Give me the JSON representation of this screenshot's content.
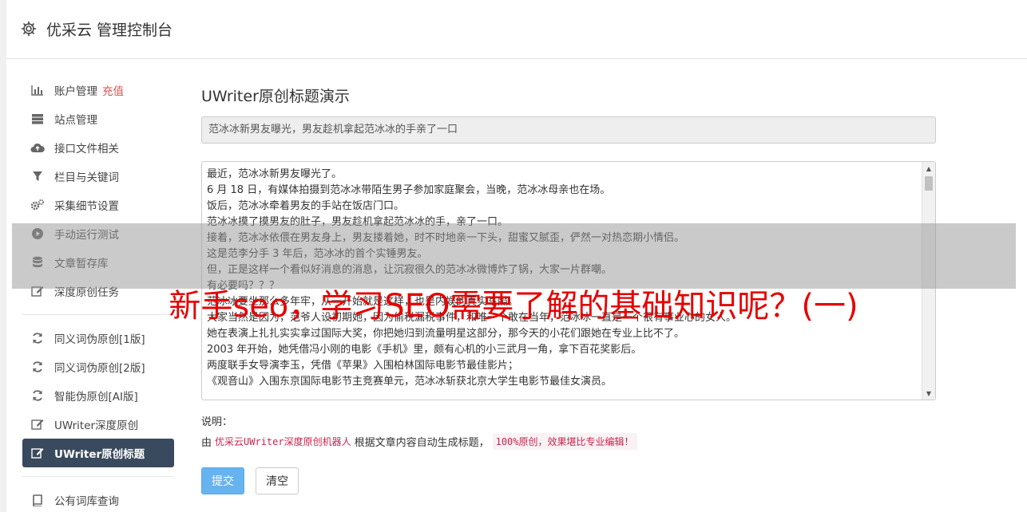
{
  "header": {
    "title": "优采云 管理控制台"
  },
  "sidebar": {
    "items": [
      {
        "label": "账户管理",
        "badge": "充值",
        "icon": "bar-chart-icon"
      },
      {
        "label": "站点管理",
        "icon": "server-icon"
      },
      {
        "label": "接口文件相关",
        "icon": "cloud-upload-icon"
      },
      {
        "label": "栏目与关键词",
        "icon": "filter-icon"
      },
      {
        "label": "采集细节设置",
        "icon": "gears-icon"
      },
      {
        "label": "手动运行测试",
        "icon": "play-icon"
      },
      {
        "label": "文章暂存库",
        "icon": "database-icon"
      },
      {
        "label": "深度原创任务",
        "icon": "edit-icon"
      },
      {
        "label": "同义词伪原创[1版]",
        "icon": "refresh-icon"
      },
      {
        "label": "同义词伪原创[2版]",
        "icon": "refresh-icon"
      },
      {
        "label": "智能伪原创[AI版]",
        "icon": "refresh-icon"
      },
      {
        "label": "UWriter深度原创",
        "icon": "edit-icon"
      },
      {
        "label": "UWriter原创标题",
        "icon": "edit-icon"
      },
      {
        "label": "公有词库查询",
        "icon": "book-icon"
      }
    ]
  },
  "main": {
    "page_title": "UWriter原创标题演示",
    "generated_title": "范冰冰新男友曝光，男友趁机拿起范冰冰的手亲了一口",
    "content_lines": [
      "最近，范冰冰新男友曝光了。",
      "6 月 18 日，有媒体拍摄到范冰冰带陌生男子参加家庭聚会，当晚，范冰冰母亲也在场。",
      "饭后，范冰冰牵着男友的手站在饭店门口。",
      "范冰冰摸了摸男友的肚子，男友趁机拿起范冰冰的手，亲了一口。",
      "接着，范冰冰依偎在男友身上，男友搂着她，时不时地亲一下头，甜蜜又腻歪，俨然一对热恋期小情侣。",
      "这是范李分手 3 年后，范冰冰的首个实锤男友。",
      "但，正是这样一个看似好消息的消息，让沉寂很久的范冰冰微博炸了锅，大家一片群嘲。",
      "有必要吗？？？",
      "范冰冰要坐那么多年牢，从一开始就是这样，也是内娱的真实写照。",
      "大家当然是因为，范爷人设初期她，因为偷税漏税事件，和唯一个敢在当年，范冰冰一直是一个很有事业心的女人。",
      "她在表演上扎扎实实拿过国际大奖，你把她归到流量明星这部分，那今天的小花们跟她在专业上比不了。",
      "2003 年开始，她凭借冯小刚的电影《手机》里，颇有心机的小三武月一角，拿下百花奖影后。",
      "两度联手女导演李玉，凭借《苹果》入围柏林国际电影节最佳影片；",
      "《观音山》入围东京国际电影节主竞赛单元，范冰冰斩获北京大学生电影节最佳女演员。"
    ],
    "note_label": "说明：",
    "note_prefix": "由",
    "note_robot": "优采云UWriter深度原创机器人",
    "note_middle": "根据文章内容自动生成标题，",
    "note_tag": "100%原创，效果堪比专业编辑！",
    "submit_label": "提交",
    "clear_label": "清空"
  },
  "overlay": {
    "title": "新手seo，学习SEO需要了解的基础知识呢？(一)"
  },
  "colors": {
    "active_nav": "#3a4a5e",
    "badge": "#d9534f",
    "overlay_text": "#e60000",
    "primary_button": "#66b3f0"
  }
}
